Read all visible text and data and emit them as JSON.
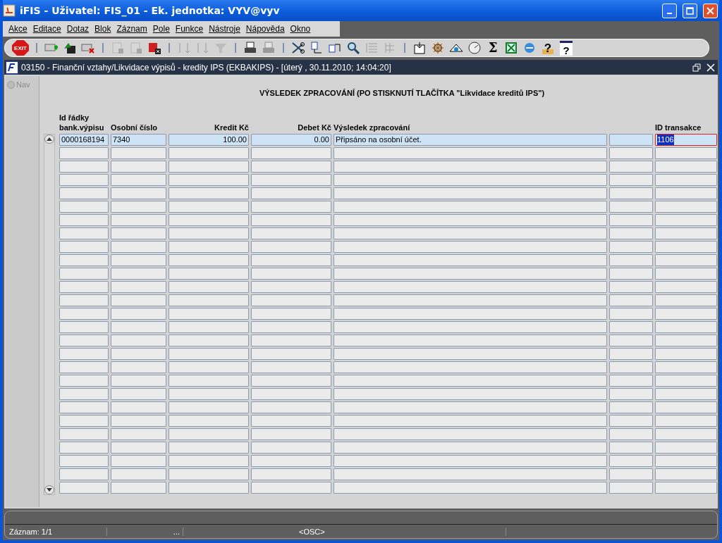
{
  "window": {
    "title": "iFIS - Uživatel: FIS_01 - Ek. jednotka: VYV@vyv"
  },
  "menu": [
    "Akce",
    "Editace",
    "Dotaz",
    "Blok",
    "Záznam",
    "Pole",
    "Funkce",
    "Nástroje",
    "Nápověda",
    "Okno"
  ],
  "toolbar": [
    {
      "kind": "exit",
      "label": "EXIT",
      "disabled": false
    },
    {
      "kind": "separator"
    },
    {
      "kind": "insert",
      "disabled": false
    },
    {
      "kind": "save",
      "disabled": false
    },
    {
      "kind": "delete",
      "disabled": false
    },
    {
      "kind": "separator"
    },
    {
      "kind": "query",
      "disabled": true
    },
    {
      "kind": "execute",
      "disabled": true
    },
    {
      "kind": "cancel",
      "disabled": false
    },
    {
      "kind": "separator"
    },
    {
      "kind": "sort-asc",
      "disabled": true
    },
    {
      "kind": "sort-desc",
      "disabled": true
    },
    {
      "kind": "filter",
      "disabled": true
    },
    {
      "kind": "separator"
    },
    {
      "kind": "print",
      "disabled": false
    },
    {
      "kind": "print-setup",
      "disabled": true
    },
    {
      "kind": "separator"
    },
    {
      "kind": "cut",
      "disabled": false
    },
    {
      "kind": "copy",
      "disabled": false
    },
    {
      "kind": "paste",
      "disabled": false
    },
    {
      "kind": "search",
      "disabled": false
    },
    {
      "kind": "list",
      "disabled": true
    },
    {
      "kind": "columns",
      "disabled": true
    },
    {
      "kind": "separator"
    },
    {
      "kind": "import",
      "disabled": false
    },
    {
      "kind": "wheel",
      "disabled": false
    },
    {
      "kind": "eye",
      "disabled": false
    },
    {
      "kind": "clock",
      "disabled": false
    },
    {
      "kind": "sum",
      "label": "Σ",
      "disabled": false
    },
    {
      "kind": "spreadsheet",
      "disabled": false
    },
    {
      "kind": "browser",
      "disabled": false
    },
    {
      "kind": "help",
      "label": "?",
      "disabled": false
    },
    {
      "kind": "context-help",
      "label": "?",
      "disabled": false
    }
  ],
  "form": {
    "title": "03150 - Finanční vztahy/Likvidace výpisů - kredity IPS (EKBAKIPS) - [úterý  , 30.11.2010; 14:04:20]",
    "nav": {
      "label": "Nav",
      "selected": false
    },
    "heading": "VÝSLEDEK ZPRACOVÁNÍ (PO STISKNUTÍ TLAČÍTKA \"Likvidace kreditů IPS\")",
    "table": {
      "columns": [
        {
          "label": "Id řádky\nbank.výpisu"
        },
        {
          "label": "Osobní číslo"
        },
        {
          "label": "Kredit Kč"
        },
        {
          "label": "Debet Kč"
        },
        {
          "label": "Výsledek zpracování"
        },
        {},
        {
          "label": "ID transakce"
        }
      ],
      "rows": [
        {
          "current": true,
          "cells": [
            {
              "text": "0000168194",
              "focused": false
            },
            {
              "text": "7340",
              "focused": false
            },
            {
              "text": "100.00",
              "focused": false
            },
            {
              "text": "0.00",
              "focused": false
            },
            {
              "text": "Připsáno na osobní účet.",
              "focused": false
            },
            {
              "focused": false
            },
            {
              "text": "1106",
              "focused": true
            }
          ]
        }
      ]
    }
  },
  "status_bar": {
    "record": "Záznam: 1/1",
    "ellipsis": "...",
    "mode": "<OSC>"
  }
}
